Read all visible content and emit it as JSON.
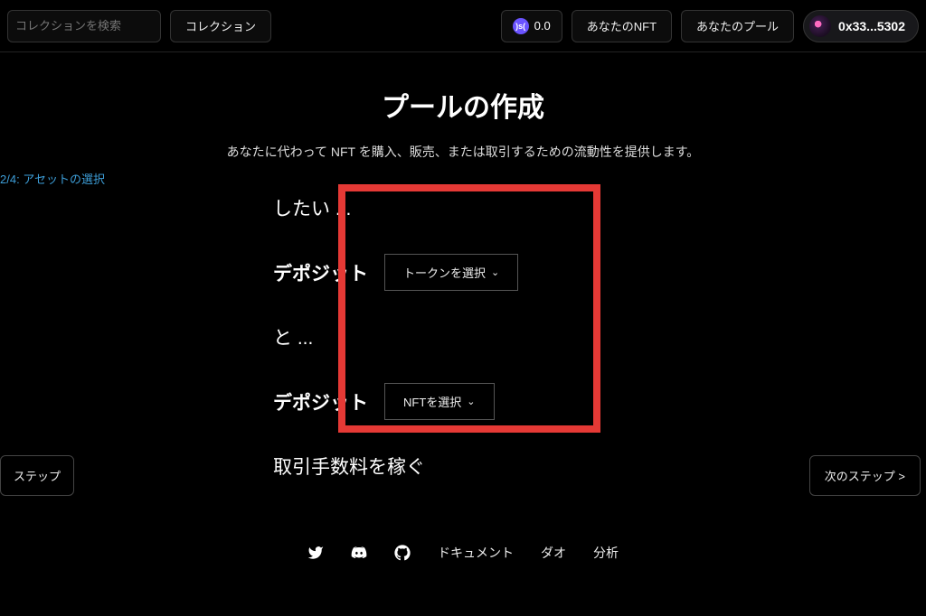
{
  "header": {
    "search_placeholder": "コレクションを検索",
    "nav_collection": "コレクション",
    "balance_value": "0.0",
    "nav_your_nft": "あなたのNFT",
    "nav_your_pool": "あなたのプール",
    "wallet_address": "0x33...5302"
  },
  "page": {
    "title": "プールの作成",
    "subtitle": "あなたに代わって NFT を購入、販売、または取引するための流動性を提供します。",
    "step_label": "2/4: アセットの選択"
  },
  "form": {
    "line1": "したい ...",
    "deposit_label": "デポジット",
    "token_select": "トークンを選択",
    "and_label": "と ...",
    "nft_select": "NFTを選択",
    "earn_label": "取引手数料を稼ぐ"
  },
  "nav": {
    "prev": "ステップ",
    "next": "次のステップ >"
  },
  "footer": {
    "docs": "ドキュメント",
    "dao": "ダオ",
    "analytics": "分析"
  }
}
